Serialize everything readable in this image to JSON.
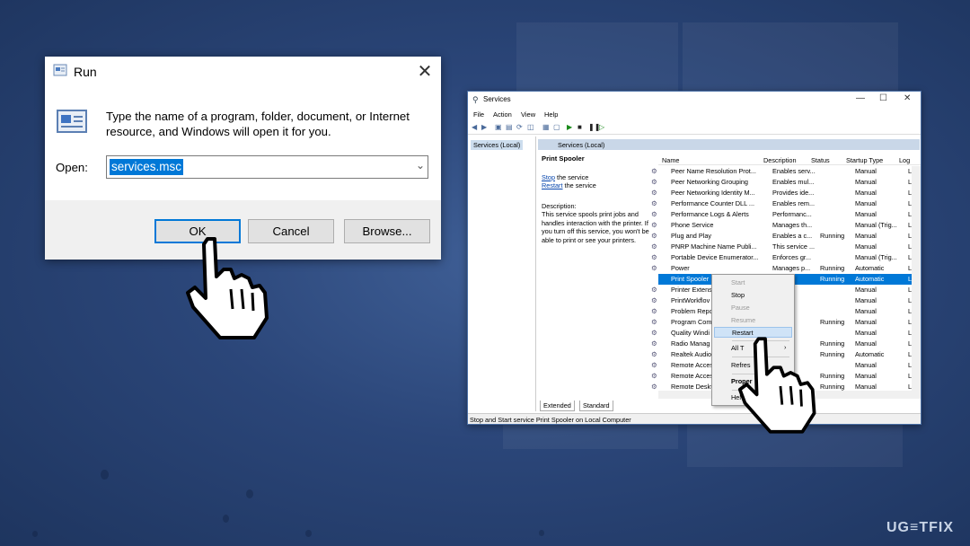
{
  "run": {
    "title": "Run",
    "close": "✕",
    "description": "Type the name of a program, folder, document, or Internet resource, and Windows will open it for you.",
    "open_label": "Open:",
    "open_value": "services.msc",
    "buttons": {
      "ok": "OK",
      "cancel": "Cancel",
      "browse": "Browse..."
    }
  },
  "services": {
    "title": "Services",
    "window_controls": {
      "min": "—",
      "max": "☐",
      "close": "✕"
    },
    "menu": [
      "File",
      "Action",
      "View",
      "Help"
    ],
    "tree_item": "Services (Local)",
    "pane_header": "Services (Local)",
    "selected_name": "Print Spooler",
    "stop_link": "Stop",
    "stop_rest": " the service",
    "restart_link": "Restart",
    "restart_rest": " the service",
    "desc_label": "Description:",
    "desc_text": "This service spools print jobs and handles interaction with the printer. If you turn off this service, you won't be able to print or see your printers.",
    "columns": [
      "Name",
      "Description",
      "Status",
      "Startup Type",
      "Log"
    ],
    "rows": [
      {
        "name": "Peer Name Resolution Prot...",
        "desc": "Enables serv...",
        "status": "",
        "startup": "Manual",
        "log": "Loc"
      },
      {
        "name": "Peer Networking Grouping",
        "desc": "Enables mul...",
        "status": "",
        "startup": "Manual",
        "log": "Loc"
      },
      {
        "name": "Peer Networking Identity M...",
        "desc": "Provides ide...",
        "status": "",
        "startup": "Manual",
        "log": "Loc"
      },
      {
        "name": "Performance Counter DLL ...",
        "desc": "Enables rem...",
        "status": "",
        "startup": "Manual",
        "log": "Loc"
      },
      {
        "name": "Performance Logs & Alerts",
        "desc": "Performanc...",
        "status": "",
        "startup": "Manual",
        "log": "Loc"
      },
      {
        "name": "Phone Service",
        "desc": "Manages th...",
        "status": "",
        "startup": "Manual (Trig...",
        "log": "Loc"
      },
      {
        "name": "Plug and Play",
        "desc": "Enables a c...",
        "status": "Running",
        "startup": "Manual",
        "log": "Loc"
      },
      {
        "name": "PNRP Machine Name Publi...",
        "desc": "This service ...",
        "status": "",
        "startup": "Manual",
        "log": "Loc"
      },
      {
        "name": "Portable Device Enumerator...",
        "desc": "Enforces gr...",
        "status": "",
        "startup": "Manual (Trig...",
        "log": "Loc"
      },
      {
        "name": "Power",
        "desc": "Manages p...",
        "status": "Running",
        "startup": "Automatic",
        "log": "Loc"
      },
      {
        "name": "Print Spooler",
        "desc": "",
        "status": "Running",
        "startup": "Automatic",
        "log": "Loc"
      },
      {
        "name": "Printer Extens",
        "desc": "",
        "status": "",
        "startup": "Manual",
        "log": "Loc"
      },
      {
        "name": "PrintWorkflov",
        "desc": "",
        "status": "",
        "startup": "Manual",
        "log": "Loc"
      },
      {
        "name": "Problem Repo",
        "desc": "",
        "status": "",
        "startup": "Manual",
        "log": "Loc"
      },
      {
        "name": "Program Com",
        "desc": "",
        "status": "Running",
        "startup": "Manual",
        "log": "Loc"
      },
      {
        "name": "Quality Windi",
        "desc": "",
        "status": "",
        "startup": "Manual",
        "log": "Loc"
      },
      {
        "name": "Radio Manag",
        "desc": "",
        "status": "Running",
        "startup": "Manual",
        "log": "Loc"
      },
      {
        "name": "Realtek Audio",
        "desc": "",
        "status": "Running",
        "startup": "Automatic",
        "log": "Loc"
      },
      {
        "name": "Remote Acces",
        "desc": "",
        "status": "",
        "startup": "Manual",
        "log": "Loc"
      },
      {
        "name": "Remote Acces",
        "desc": "",
        "status": "Running",
        "startup": "Manual",
        "log": "Loc"
      },
      {
        "name": "Remote Deskt",
        "desc": "",
        "status": "Running",
        "startup": "Manual",
        "log": "Loc"
      }
    ],
    "tabs": [
      "Extended",
      "Standard"
    ],
    "status_bar": "Stop and Start service Print Spooler on Local Computer"
  },
  "context_menu": {
    "start": "Start",
    "stop": "Stop",
    "pause": "Pause",
    "resume": "Resume",
    "restart": "Restart",
    "all_tasks": "All T",
    "refresh": "Refres",
    "properties": "Proper",
    "help": "Hel",
    "submenu_arrow": "›"
  },
  "watermark": "UG≡TFIX",
  "icons": {
    "run_title": "run-window-icon",
    "run_body": "run-dialog-icon",
    "hand": "hand-cursor-icon"
  },
  "colors": {
    "selection": "#0078d7",
    "background": "#2b4679"
  }
}
